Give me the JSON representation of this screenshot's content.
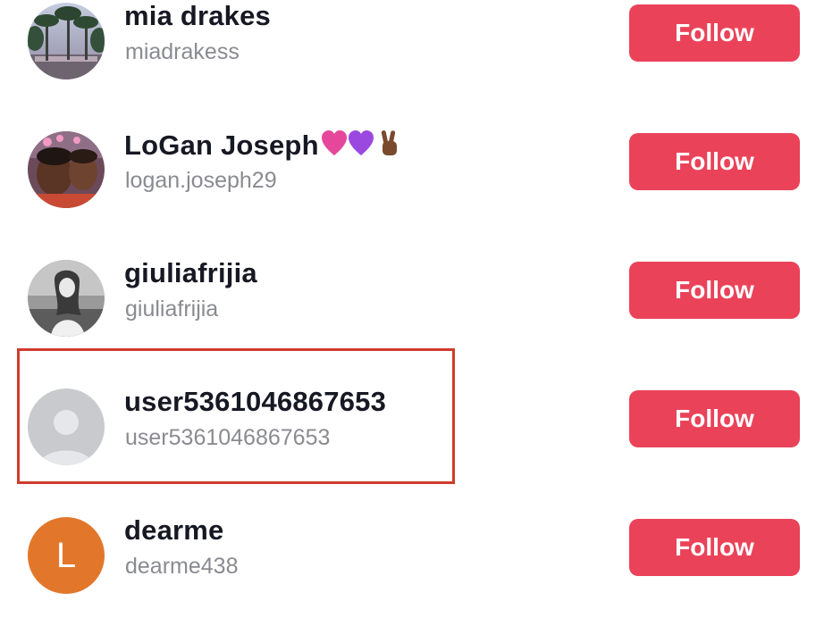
{
  "users": [
    {
      "name": "mia drakes",
      "name_emoji": "",
      "handle": "miadrakess",
      "button_label": "Follow",
      "avatar_type": "photo-palm-trees"
    },
    {
      "name": "LoGan Joseph",
      "name_emoji": "💗💜✌🏾",
      "handle": "logan.joseph29",
      "button_label": "Follow",
      "avatar_type": "photo-selfie"
    },
    {
      "name": "giuliafrijia",
      "name_emoji": "",
      "handle": "giuliafrijia",
      "button_label": "Follow",
      "avatar_type": "photo-monochrome"
    },
    {
      "name": "user5361046867653",
      "name_emoji": "",
      "handle": "user5361046867653",
      "button_label": "Follow",
      "avatar_type": "default-person-icon",
      "highlighted": true
    },
    {
      "name": "dearme",
      "name_emoji": "",
      "handle": "dearme438",
      "button_label": "Follow",
      "avatar_type": "letter",
      "avatar_letter": "L"
    }
  ],
  "colors": {
    "follow_button": "#ea4359",
    "highlight_border": "#d03b2b",
    "name_text": "#161823",
    "handle_text": "#8a8b91",
    "letter_avatar_bg": "#e2772b",
    "default_avatar_bg": "#c9cace"
  }
}
